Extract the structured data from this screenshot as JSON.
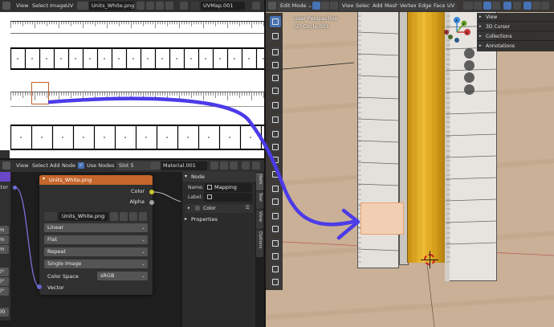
{
  "uv_editor": {
    "header": {
      "menus": [
        "View",
        "Select",
        "Image",
        "UV"
      ],
      "image_name": "Units_White.png",
      "uvmap_name": "UVMap.001"
    }
  },
  "node_editor": {
    "header": {
      "menus": [
        "View",
        "Select",
        "Add",
        "Node"
      ],
      "use_nodes_label": "Use Nodes",
      "use_nodes_checked": true,
      "slot": "Slot 5",
      "material": "Material.001"
    },
    "left_node_partial": {
      "socket_label": "ctor",
      "field_values": [
        "m",
        "m",
        "m",
        "0°",
        "0°",
        "0°",
        "00"
      ]
    },
    "image_node": {
      "title": "Units_White.png",
      "outputs": [
        "Color",
        "Alpha"
      ],
      "image_name": "Units_White.png",
      "interpolation": "Linear",
      "projection": "Flat",
      "extension": "Repeat",
      "source": "Single Image",
      "color_space_label": "Color Space",
      "color_space_value": "sRGB",
      "input_label": "Vector"
    },
    "sidebar": {
      "node_section": "Node",
      "name_label": "Name:",
      "name_value": "Mapping",
      "label_label": "Label:",
      "label_value": "",
      "color_label": "Color",
      "properties_section": "Properties",
      "tabs": [
        "Item",
        "Tool",
        "View",
        "Options"
      ]
    }
  },
  "viewport": {
    "header": {
      "mode": "Edit Mode",
      "menus": [
        "View",
        "Select",
        "Add",
        "Mesh",
        "Vertex",
        "Edge",
        "Face",
        "UV"
      ]
    },
    "overlay_text": {
      "perspective": "User Perspective",
      "object": "(2) Circle.001"
    },
    "gizmo_axes": [
      "z",
      "y",
      "x"
    ],
    "sidebar_panels": [
      "View",
      "3D Cursor",
      "Collections",
      "Annotations"
    ]
  },
  "colors": {
    "accent_blue": "#4772b3",
    "image_node_header": "#c5662c",
    "annotation_arrow": "#4b3be8",
    "selected_face": "#f2cfb3",
    "viewport_floor": "#c6ad93",
    "gold_column": "#d9a21b"
  }
}
